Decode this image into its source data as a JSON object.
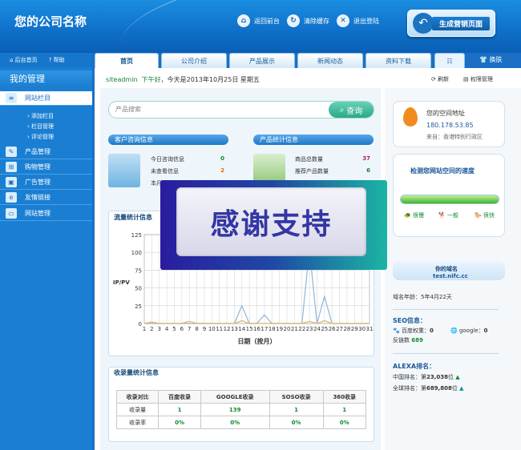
{
  "header": {
    "logo": "您的公司名称",
    "buttons": [
      {
        "label": "返回前台",
        "icon": "home-icon"
      },
      {
        "label": "清除缓存",
        "icon": "refresh-icon"
      },
      {
        "label": "退出登陆",
        "icon": "close-icon"
      }
    ],
    "generate": "生成营销页面"
  },
  "topnav": {
    "home": "后台首页",
    "help": "帮助"
  },
  "tabs": [
    "首页",
    "公司介绍",
    "产品展示",
    "新闻动态",
    "资料下载",
    "☷"
  ],
  "swap": "换肤",
  "sidebar": {
    "title": "我的管理",
    "items": [
      "网站栏目",
      "产品管理",
      "购物管理",
      "广告管理",
      "友情链接",
      "网站管理"
    ],
    "subitems": [
      "添加栏目",
      "栏目管理",
      "评论管理"
    ]
  },
  "greet": {
    "user": "siteadmin",
    "hello": "下午好",
    "date": "今天是2013年10月25日 星期五"
  },
  "actions": {
    "refresh": "刷新",
    "perm": "权限管理"
  },
  "search": {
    "placeholder": "产品搜索",
    "button": "查询"
  },
  "consult": {
    "title": "客户咨询信息",
    "rows": [
      {
        "label": "今日咨询信息",
        "value": "0",
        "color": "#118a2d"
      },
      {
        "label": "未查看信息",
        "value": "2",
        "color": "#e66b0d"
      },
      {
        "label": "本月...",
        "value": ""
      }
    ]
  },
  "product": {
    "title": "产品统计信息",
    "rows": [
      {
        "label": "商品总数量",
        "value": "37",
        "color": "#c2185b"
      },
      {
        "label": "推荐产品数量",
        "value": "6",
        "color": "#118a2d"
      }
    ]
  },
  "chart_data": {
    "type": "line",
    "title": "流量统计信息",
    "xlabel": "日期（按月）",
    "ylabel": "IP/PV",
    "ylim": [
      0,
      125
    ],
    "yticks": [
      0,
      25,
      50,
      75,
      100,
      125
    ],
    "x": [
      "1",
      "2",
      "3",
      "4",
      "5",
      "6",
      "7",
      "8",
      "9",
      "10",
      "11",
      "12",
      "13",
      "14",
      "15",
      "16",
      "17",
      "18",
      "19",
      "20",
      "21",
      "22",
      "23",
      "24",
      "25",
      "26",
      "27",
      "28",
      "29",
      "30",
      "31"
    ],
    "series": [
      {
        "values": [
          0,
          0,
          0,
          0,
          0,
          0,
          0,
          0,
          0,
          0,
          0,
          0,
          0,
          25,
          0,
          0,
          12,
          0,
          0,
          0,
          0,
          0,
          105,
          0,
          38,
          0,
          0,
          0,
          0,
          0,
          0
        ],
        "color": "#8fb6d8"
      },
      {
        "values": [
          0,
          2,
          0,
          0,
          0,
          0,
          3,
          0,
          0,
          0,
          0,
          0,
          0,
          4,
          0,
          0,
          0,
          0,
          0,
          0,
          0,
          0,
          3,
          0,
          4,
          0,
          0,
          0,
          0,
          0,
          0
        ],
        "color": "#e3b15b"
      }
    ]
  },
  "collect": {
    "title": "收录量统计信息",
    "headers": [
      "收录对比",
      "百度收录",
      "GOOGLE收录",
      "SOSO收录",
      "360收录"
    ],
    "rows": [
      [
        "收录量",
        "1",
        "139",
        "1",
        "1"
      ],
      [
        "收录率",
        "0%",
        "0%",
        "0%",
        "0%"
      ]
    ]
  },
  "overlay": "感谢支持",
  "ipbox": {
    "title": "您的空间地址",
    "ip": "180.178.53.85",
    "loc": "来自：香港特别行政区"
  },
  "speed": {
    "title": "检测您网站空间的速度",
    "levels": [
      "很慢",
      "一般",
      "很快"
    ]
  },
  "domain": {
    "title": "你的域名",
    "value": "test.nifc.cc",
    "age_label": "域名年龄：",
    "age": "5年4月22天"
  },
  "seo": {
    "title": "SEO信息：",
    "baidu_label": "百度权重：",
    "baidu": "0",
    "google_label": "google：",
    "google": "0",
    "backlinks_label": "反链数",
    "backlinks": "689"
  },
  "alexa": {
    "title": "ALEXA排名：",
    "cn_label": "中国排名：",
    "cn_prefix": "第",
    "cn": "23,038",
    "cn_suffix": "位",
    "global_label": "全球排名：",
    "global_prefix": "第",
    "global": "689,808",
    "global_suffix": "位"
  }
}
